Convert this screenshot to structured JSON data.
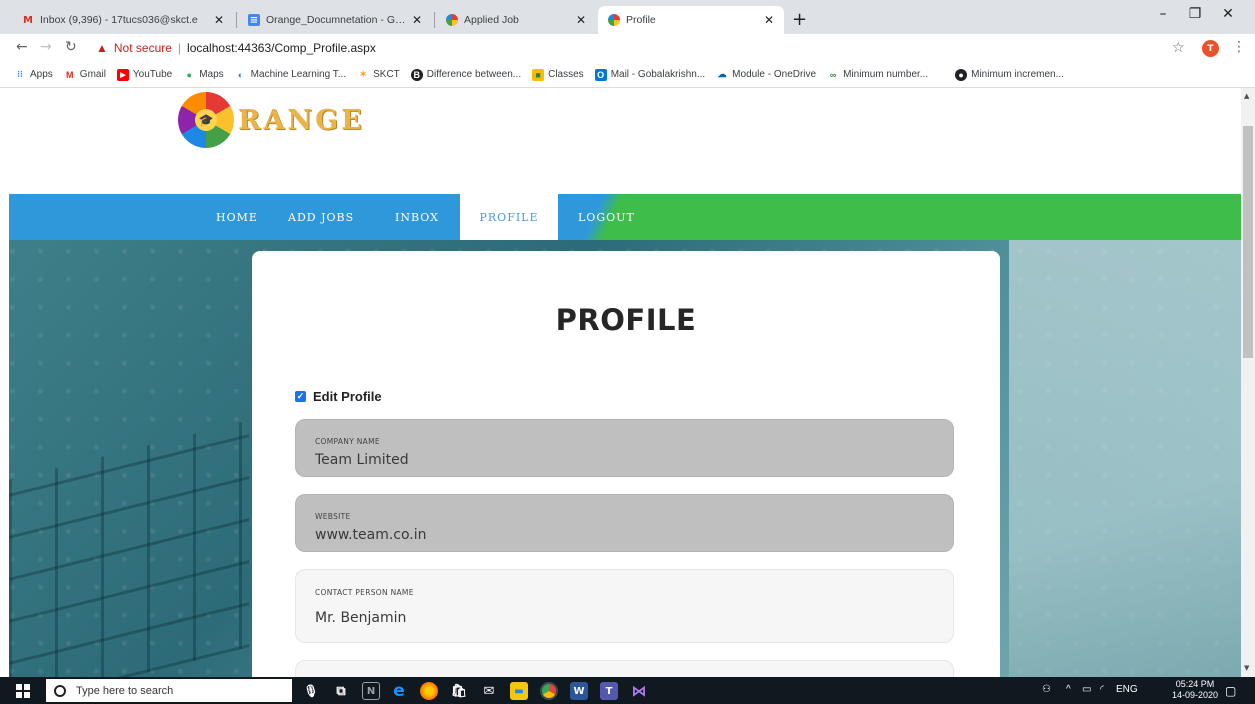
{
  "browser": {
    "tabs": [
      {
        "title": "Inbox (9,396) - 17tucs036@skct.e",
        "favicon": "gmail-icon",
        "color": "#d93025"
      },
      {
        "title": "Orange_Documnetation - Googl",
        "favicon": "docs-icon",
        "color": "#4285f4"
      },
      {
        "title": "Applied Job",
        "favicon": "orange-logo-icon",
        "color": "#f9a825"
      },
      {
        "title": "Profile",
        "favicon": "orange-logo-icon",
        "color": "#f9a825"
      }
    ],
    "address": {
      "warning": "Not secure",
      "url": "localhost:44363/Comp_Profile.aspx"
    },
    "profile_initial": "T",
    "bookmarks": [
      {
        "label": "Apps",
        "icon": "apps-grid-icon",
        "color": "#4285f4"
      },
      {
        "label": "Gmail",
        "icon": "gmail-icon",
        "color": "#d93025"
      },
      {
        "label": "YouTube",
        "icon": "youtube-icon",
        "color": "#ff0000"
      },
      {
        "label": "Maps",
        "icon": "maps-pin-icon",
        "color": "#34a853"
      },
      {
        "label": "Machine Learning T...",
        "icon": "ml-icon",
        "color": "#1a73e8"
      },
      {
        "label": "SKCT",
        "icon": "skct-icon",
        "color": "#f9a825"
      },
      {
        "label": "Difference between...",
        "icon": "b-icon",
        "color": "#202124"
      },
      {
        "label": "Classes",
        "icon": "classroom-icon",
        "color": "#fbbc04"
      },
      {
        "label": "Mail - Gobalakrishn...",
        "icon": "outlook-icon",
        "color": "#0078d4"
      },
      {
        "label": "Module - OneDrive",
        "icon": "onedrive-icon",
        "color": "#0364b8"
      },
      {
        "label": "Minimum number...",
        "icon": "gfg-icon",
        "color": "#2f8d46"
      },
      {
        "label": "Minimum incremen...",
        "icon": "github-icon",
        "color": "#202124"
      }
    ]
  },
  "site": {
    "logo_text": "RANGE",
    "nav": [
      {
        "label": "HOME",
        "active": false
      },
      {
        "label": "ADD JOBS",
        "active": false
      },
      {
        "label": "INBOX",
        "active": false
      },
      {
        "label": "PROFILE",
        "active": true
      },
      {
        "label": "LOGOUT",
        "active": false
      }
    ],
    "colors": {
      "nav_blue": "#2f98db",
      "nav_green": "#3ebd4b",
      "active_text": "#4a9bd6"
    }
  },
  "profile": {
    "title": "PROFILE",
    "edit_label": "Edit Profile",
    "edit_checked": true,
    "fields": [
      {
        "label": "COMPANY NAME",
        "value": "Team Limited",
        "editable": false
      },
      {
        "label": "WEBSITE",
        "value": "www.team.co.in",
        "editable": false
      },
      {
        "label": "CONTACT PERSON NAME",
        "value": "Mr. Benjamin",
        "editable": true
      },
      {
        "label": "",
        "value": "",
        "editable": true
      }
    ]
  },
  "taskbar": {
    "search_placeholder": "Type here to search",
    "lang": "ENG",
    "time": "05:24 PM",
    "date": "14-09-2020"
  }
}
